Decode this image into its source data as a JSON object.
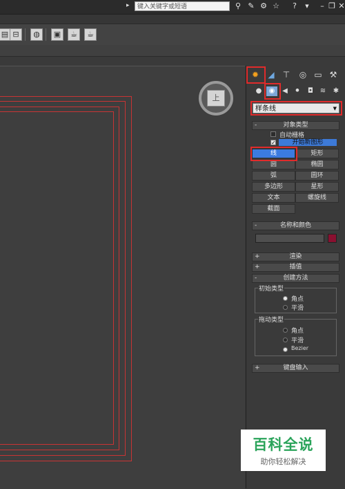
{
  "top": {
    "search_placeholder": "键入关键字或短语",
    "icons": [
      "binoculars-icon",
      "tools-icon",
      "exchange-icon",
      "star-icon",
      "help-icon",
      "minimize-icon",
      "restore-icon",
      "close-icon"
    ],
    "arrow": "▸"
  },
  "toolbar": {
    "icons": [
      "toolbar-icon-1",
      "toolbar-icon-2",
      "render-setup-icon",
      "rendered-frame-icon",
      "render-teapot-icon",
      "render-active-icon"
    ]
  },
  "viewport": {
    "viewcube_label": "上",
    "shape_color": "#c93434"
  },
  "panel": {
    "main_tabs": [
      "create-tab",
      "modify-tab",
      "hierarchy-tab",
      "motion-tab",
      "display-tab",
      "utilities-tab"
    ],
    "sub_tabs": [
      "geometry-tab",
      "shapes-tab",
      "lights-tab",
      "cameras-tab",
      "helpers-tab",
      "spacewarps-tab",
      "systems-tab"
    ],
    "category_dropdown": "样条线",
    "object_type": {
      "title": "对象类型",
      "autogrid_label": "自动栅格",
      "start_new_shape_label": "开始新图形",
      "buttons": [
        "线",
        "矩形",
        "圆",
        "椭圆",
        "弧",
        "圆环",
        "多边形",
        "星形",
        "文本",
        "螺旋线",
        "截面"
      ],
      "selected": "线"
    },
    "name_color": {
      "title": "名称和颜色",
      "name_value": "",
      "swatch_color": "#8a1030"
    },
    "rendering": {
      "title": "渲染"
    },
    "interpolation": {
      "title": "插值"
    },
    "creation_method": {
      "title": "创建方法",
      "initial_type": {
        "label": "初始类型",
        "options": [
          "角点",
          "平滑"
        ],
        "selected": "角点"
      },
      "drag_type": {
        "label": "拖动类型",
        "options": [
          "角点",
          "平滑",
          "Bezier"
        ],
        "selected": "Bezier"
      }
    },
    "keyboard_entry": {
      "title": "键盘输入"
    },
    "expand_sign": "+",
    "collapse_sign": "-"
  },
  "watermark": {
    "main": "百科全说",
    "sub": "助你轻松解决",
    "color": "#2aa35a"
  }
}
